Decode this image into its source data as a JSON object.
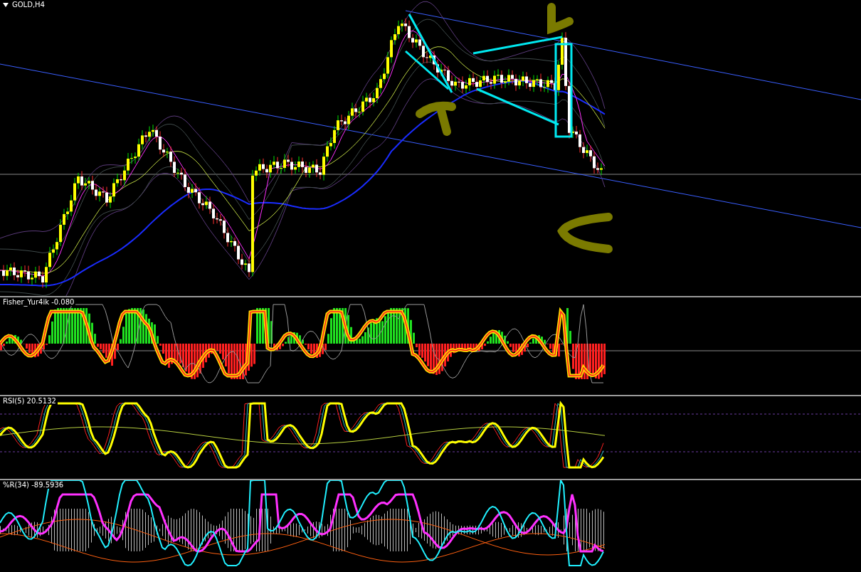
{
  "main_chart": {
    "title": "GOLD,H4"
  },
  "indicators": [
    {
      "kind": "fisher",
      "label": "Fisher_Yur4ik -0.080"
    },
    {
      "kind": "rsi",
      "label": "RSI(5) 20.5132"
    },
    {
      "kind": "williams",
      "label": "%R(34) -89.5936"
    }
  ]
}
